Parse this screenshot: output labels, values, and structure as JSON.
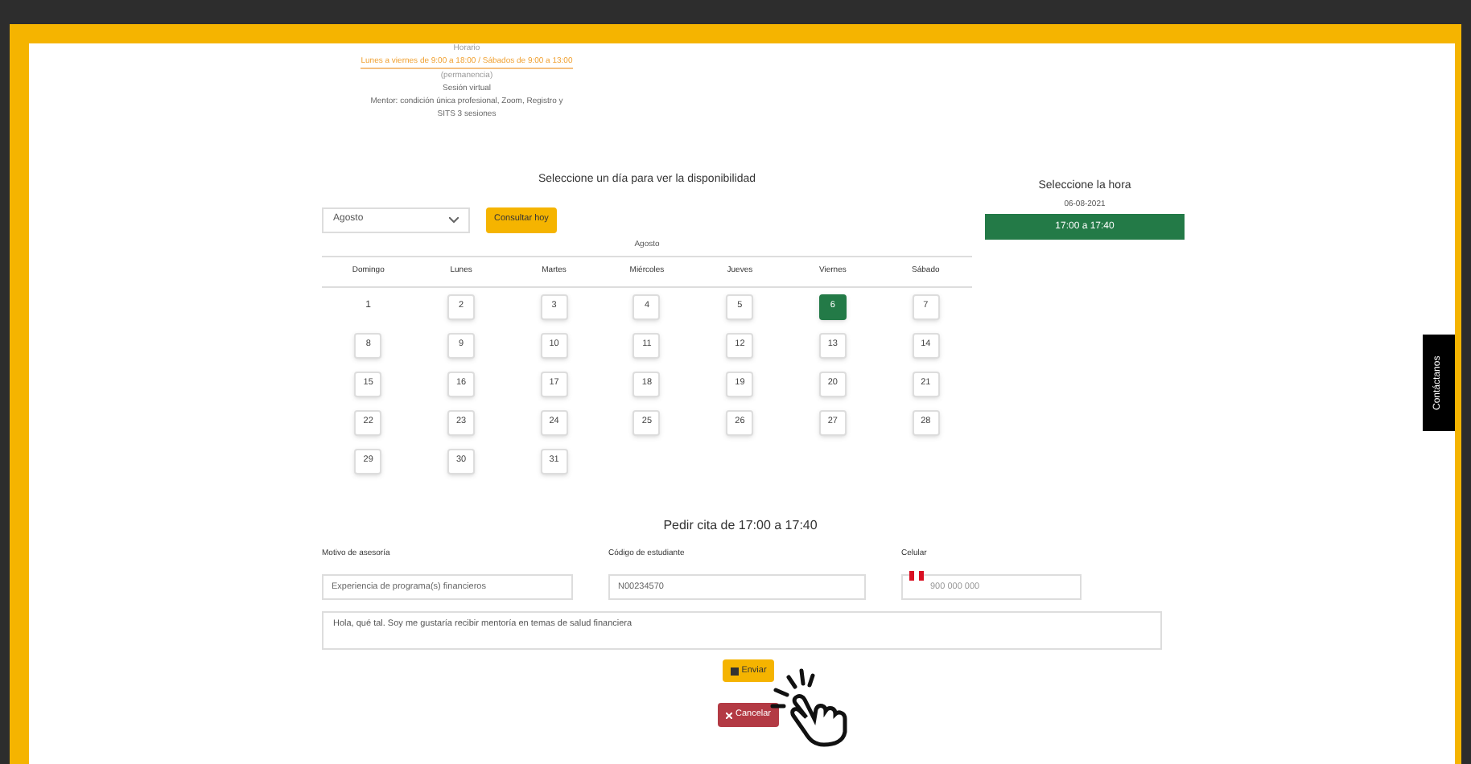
{
  "info": {
    "lines": [
      {
        "kind": "muted",
        "text": "Horario"
      },
      {
        "kind": "link",
        "text": "Lunes a viernes de 9:00 a 18:00 / Sábados de 9:00 a 13:00"
      },
      {
        "kind": "muted",
        "text": "(permanencia)"
      },
      {
        "kind": "text",
        "text": "Sesión virtual"
      },
      {
        "kind": "text",
        "text": "Mentor: condición única profesional, Zoom, Registro y"
      },
      {
        "kind": "text",
        "text": "SITS 3 sesiones"
      }
    ]
  },
  "calendar": {
    "title": "Seleccione un día para ver la disponibilidad",
    "month_select": "Agosto",
    "today_button": "Consultar hoy",
    "month_label": "Agosto",
    "weekdays": [
      "Domingo",
      "Lunes",
      "Martes",
      "Miércoles",
      "Jueves",
      "Viernes",
      "Sábado"
    ],
    "weeks": [
      [
        {
          "day": "1",
          "kind": "plain"
        },
        {
          "day": "2",
          "kind": "button",
          "selected": false
        },
        {
          "day": "3",
          "kind": "button",
          "selected": false
        },
        {
          "day": "4",
          "kind": "button",
          "selected": false
        },
        {
          "day": "5",
          "kind": "button",
          "selected": false
        },
        {
          "day": "6",
          "kind": "button",
          "selected": true
        },
        {
          "day": "7",
          "kind": "button",
          "selected": false
        }
      ],
      [
        {
          "day": "8",
          "kind": "button",
          "selected": false
        },
        {
          "day": "9",
          "kind": "button",
          "selected": false
        },
        {
          "day": "10",
          "kind": "button",
          "selected": false
        },
        {
          "day": "11",
          "kind": "button",
          "selected": false
        },
        {
          "day": "12",
          "kind": "button",
          "selected": false
        },
        {
          "day": "13",
          "kind": "button",
          "selected": false
        },
        {
          "day": "14",
          "kind": "button",
          "selected": false
        }
      ],
      [
        {
          "day": "15",
          "kind": "button",
          "selected": false
        },
        {
          "day": "16",
          "kind": "button",
          "selected": false
        },
        {
          "day": "17",
          "kind": "button",
          "selected": false
        },
        {
          "day": "18",
          "kind": "button",
          "selected": false
        },
        {
          "day": "19",
          "kind": "button",
          "selected": false
        },
        {
          "day": "20",
          "kind": "button",
          "selected": false
        },
        {
          "day": "21",
          "kind": "button",
          "selected": false
        }
      ],
      [
        {
          "day": "22",
          "kind": "button",
          "selected": false
        },
        {
          "day": "23",
          "kind": "button",
          "selected": false
        },
        {
          "day": "24",
          "kind": "button",
          "selected": false
        },
        {
          "day": "25",
          "kind": "button",
          "selected": false
        },
        {
          "day": "26",
          "kind": "button",
          "selected": false
        },
        {
          "day": "27",
          "kind": "button",
          "selected": false
        },
        {
          "day": "28",
          "kind": "button",
          "selected": false
        }
      ],
      [
        {
          "day": "29",
          "kind": "button",
          "selected": false
        },
        {
          "day": "30",
          "kind": "button",
          "selected": false
        },
        {
          "day": "31",
          "kind": "button",
          "selected": false
        }
      ]
    ]
  },
  "time": {
    "title": "Seleccione la hora",
    "date": "06-08-2021",
    "slots": [
      {
        "label": "17:00 a 17:40",
        "selected": true
      }
    ]
  },
  "form": {
    "heading": "Pedir cita de 17:00 a 17:40",
    "fields": [
      {
        "label": "Motivo de asesoría",
        "value": "Experiencia de programa(s) financieros",
        "kind": "text"
      },
      {
        "label": "Código de estudiante",
        "value": "N00234570",
        "kind": "text"
      },
      {
        "label": "Celular",
        "placeholder": "900 000 000",
        "kind": "phone"
      }
    ],
    "message": "Hola, qué tal. Soy me gustaría recibir mentoría en temas de salud financiera",
    "submit": "Enviar",
    "cancel": "Cancelar"
  },
  "side_tab": "Contáctanos"
}
